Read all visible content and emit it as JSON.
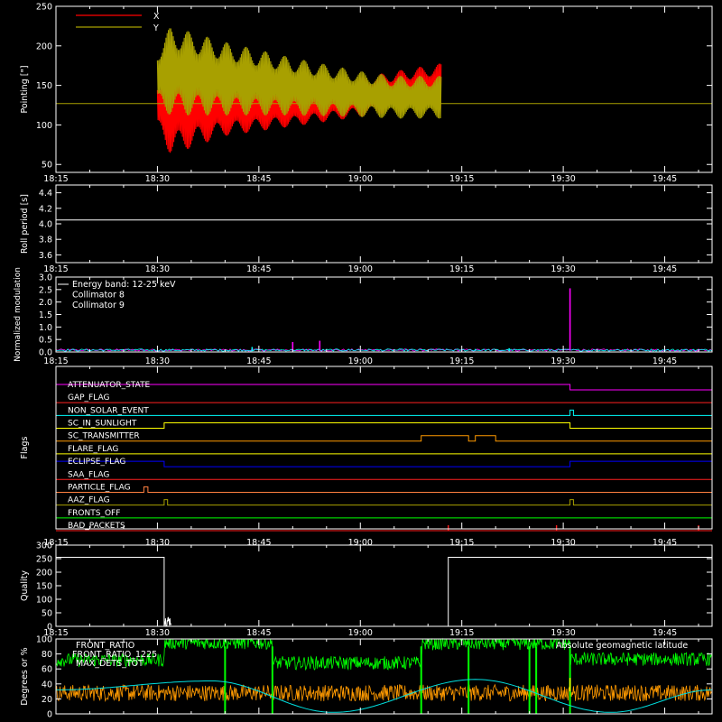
{
  "x_ticks": [
    "18:15",
    "18:30",
    "18:45",
    "19:00",
    "19:15",
    "19:30",
    "19:45"
  ],
  "time_range": [
    "18:15",
    "19:52"
  ],
  "chart_data": [
    {
      "type": "line",
      "ylabel": "Pointing [\"]",
      "ylim": [
        40,
        250
      ],
      "yticks": [
        50,
        100,
        150,
        200,
        250
      ],
      "legend": [
        {
          "name": "X",
          "color": "#ff0000"
        },
        {
          "name": "Y",
          "color": "#a8a000"
        }
      ],
      "series": [
        {
          "name": "X",
          "color": "#ff0000",
          "envelope": [
            {
              "t": "18:30",
              "min": 90,
              "max": 160
            },
            {
              "t": "18:32",
              "min": 62,
              "max": 180
            },
            {
              "t": "18:40",
              "min": 86,
              "max": 160
            },
            {
              "t": "18:50",
              "min": 98,
              "max": 150
            },
            {
              "t": "19:00",
              "min": 110,
              "max": 160
            },
            {
              "t": "19:05",
              "min": 116,
              "max": 168
            },
            {
              "t": "19:12",
              "min": 120,
              "max": 178
            }
          ]
        },
        {
          "name": "Y",
          "color": "#a8a000",
          "envelope": [
            {
              "t": "18:30",
              "min": 120,
              "max": 200
            },
            {
              "t": "18:32",
              "min": 112,
              "max": 225
            },
            {
              "t": "18:40",
              "min": 112,
              "max": 205
            },
            {
              "t": "18:50",
              "min": 112,
              "max": 185
            },
            {
              "t": "19:00",
              "min": 110,
              "max": 168
            },
            {
              "t": "19:05",
              "min": 108,
              "max": 162
            },
            {
              "t": "19:12",
              "min": 108,
              "max": 162
            }
          ]
        }
      ],
      "reference_line": {
        "value": 127,
        "color": "#a8a000"
      }
    },
    {
      "type": "line",
      "ylabel": "Roll period [s]",
      "ylim": [
        3.5,
        4.5
      ],
      "yticks": [
        3.6,
        3.8,
        4.0,
        4.2,
        4.4
      ],
      "series": [
        {
          "name": "",
          "color": "#ffffff",
          "constant": 4.05
        }
      ]
    },
    {
      "type": "line",
      "ylabel": "Normalized modulation",
      "ylim": [
        0,
        3.0
      ],
      "yticks": [
        0.0,
        0.5,
        1.0,
        1.5,
        2.0,
        2.5,
        3.0
      ],
      "legend": [
        {
          "name": "Energy band: 12-25 keV",
          "color": "#ffffff"
        },
        {
          "name": "Collimator 8",
          "color": "#00ffff"
        },
        {
          "name": "Collimator 9",
          "color": "#ff00ff"
        }
      ],
      "spikes": [
        {
          "t": "18:44",
          "value": 0.2,
          "color": "#00ffff"
        },
        {
          "t": "18:50",
          "value": 0.4,
          "color": "#ff00ff"
        },
        {
          "t": "18:54",
          "value": 0.45,
          "color": "#ff00ff"
        },
        {
          "t": "19:17",
          "value": 0.12,
          "color": "#00ffff"
        },
        {
          "t": "19:22",
          "value": 0.15,
          "color": "#00ffff"
        },
        {
          "t": "19:31",
          "value": 2.55,
          "color": "#ff00ff"
        },
        {
          "t": "19:50",
          "value": 0.12,
          "color": "#ff00ff"
        }
      ]
    },
    {
      "type": "timeline",
      "ylabel": "Flags",
      "flags": [
        {
          "name": "ATTENUATOR_STATE",
          "color": "#ff00ff",
          "high": [
            [
              "18:15",
              "19:31"
            ]
          ]
        },
        {
          "name": "GAP_FLAG",
          "color": "#ff2020",
          "high": []
        },
        {
          "name": "NON_SOLAR_EVENT",
          "color": "#00ffff",
          "high": [
            [
              "19:31",
              "19:31.5"
            ]
          ]
        },
        {
          "name": "SC_IN_SUNLIGHT",
          "color": "#ffff00",
          "high": [
            [
              "18:31",
              "19:31"
            ]
          ]
        },
        {
          "name": "SC_TRANSMITTER",
          "color": "#ff9a00",
          "high": [
            [
              "19:09",
              "19:16"
            ],
            [
              "19:17",
              "19:20"
            ]
          ]
        },
        {
          "name": "FLARE_FLAG",
          "color": "#ffff00",
          "high": []
        },
        {
          "name": "ECLIPSE_FLAG",
          "color": "#0000ff",
          "high": [
            [
              "18:15",
              "18:31"
            ],
            [
              "19:31",
              "19:52"
            ]
          ]
        },
        {
          "name": "SAA_FLAG",
          "color": "#ff2020",
          "high": []
        },
        {
          "name": "PARTICLE_FLAG",
          "color": "#ff8040",
          "high": [
            [
              "18:28",
              "18:28.6"
            ]
          ]
        },
        {
          "name": "AAZ_FLAG",
          "color": "#a8a000",
          "high": [
            [
              "18:31",
              "18:31.5"
            ],
            [
              "19:31",
              "19:31.5"
            ]
          ]
        },
        {
          "name": "FRONTS_OFF",
          "color": "#00ff00",
          "high": []
        },
        {
          "name": "BAD_PACKETS",
          "color": "#ff2020",
          "spikes": [
            "19:13",
            "19:29",
            "19:50"
          ]
        }
      ]
    },
    {
      "type": "line",
      "ylabel": "Quality",
      "ylim": [
        0,
        300
      ],
      "yticks": [
        0,
        50,
        100,
        150,
        200,
        250,
        300
      ],
      "series": [
        {
          "name": "",
          "color": "#ffffff",
          "segments": [
            {
              "from": "18:15",
              "to": "18:31",
              "value": 255
            },
            {
              "from": "18:31",
              "to": "19:13",
              "value": 0
            },
            {
              "from": "19:13",
              "to": "19:52",
              "value": 255
            }
          ]
        }
      ]
    },
    {
      "type": "line",
      "ylabel": "Degrees or %",
      "ylim": [
        0,
        100
      ],
      "yticks": [
        0,
        20,
        40,
        60,
        80,
        100
      ],
      "legend": [
        {
          "name": "FRONT_RATIO",
          "color": "#ffff00"
        },
        {
          "name": "FRONT_RATIO_1225",
          "color": "#00ff00"
        },
        {
          "name": "MAX_DETS_TOT",
          "color": "#ff9a00"
        },
        {
          "name": "Absolute geomagnetic latitude",
          "color": "#00e0e0"
        }
      ],
      "series": [
        {
          "name": "FRONT_RATIO_1225",
          "color": "#00ff00",
          "levels": [
            {
              "from": "18:15",
              "to": "18:31",
              "value": 72
            },
            {
              "from": "18:31",
              "to": "18:47",
              "value": 95
            },
            {
              "from": "18:47",
              "to": "19:09",
              "value": 68
            },
            {
              "from": "19:09",
              "to": "19:31",
              "value": 94
            },
            {
              "from": "19:31",
              "to": "19:52",
              "value": 73
            }
          ]
        },
        {
          "name": "MAX_DETS_TOT",
          "color": "#ff9a00",
          "levels": [
            {
              "from": "18:15",
              "to": "19:52",
              "value": 28
            }
          ]
        },
        {
          "name": "Absolute geomagnetic latitude",
          "color": "#00e0e0",
          "nodes": [
            {
              "t": "18:15",
              "value": 32
            },
            {
              "t": "18:38",
              "value": 44
            },
            {
              "t": "18:56",
              "value": 2
            },
            {
              "t": "19:17",
              "value": 46
            },
            {
              "t": "19:37",
              "value": 2
            },
            {
              "t": "19:52",
              "value": 32
            }
          ]
        }
      ],
      "drops": [
        "18:40",
        "18:47",
        "19:09",
        "19:16",
        "19:25",
        "19:26",
        "19:31"
      ]
    }
  ]
}
